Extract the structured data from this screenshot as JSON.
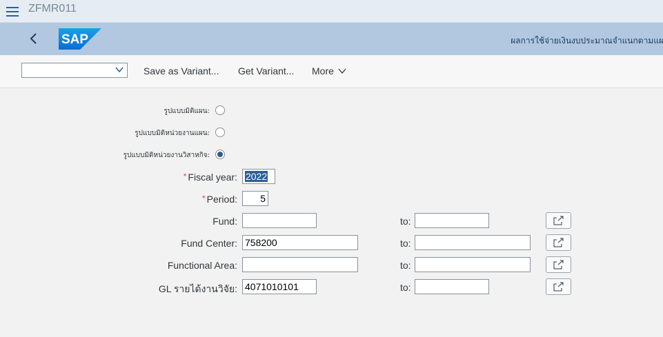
{
  "titlebar": {
    "transaction_code": "ZFMR011"
  },
  "shell": {
    "title": "ผลการใช้จ่ายเงินงบประมาณจำแนกตามแผนงาน"
  },
  "toolbar": {
    "variant_value": "",
    "save_as_variant": "Save as Variant...",
    "get_variant": "Get Variant...",
    "more": "More"
  },
  "form": {
    "radios": [
      {
        "label": "รูปแบบมิติแผน:",
        "selected": false
      },
      {
        "label": "รูปแบบมิติหน่วยงานแผน:",
        "selected": false
      },
      {
        "label": "รูปแบบมิติหน่วยงานวิสาหกิจ:",
        "selected": true
      }
    ],
    "fiscal_year_label": "Fiscal year:",
    "fiscal_year_value": "2022",
    "period_label": "Period:",
    "period_value": "5",
    "to_label": "to:",
    "fund": {
      "label": "Fund:",
      "from": "",
      "to": ""
    },
    "fund_center": {
      "label": "Fund Center:",
      "from": "758200",
      "to": ""
    },
    "functional_area": {
      "label": "Functional Area:",
      "from": "",
      "to": ""
    },
    "gl": {
      "label": "GL รายได้งานวิจัย:",
      "from": "4071010101",
      "to": ""
    }
  },
  "colors": {
    "shell_bg": "#b1c8e0",
    "accent": "#2b5d91",
    "required": "#e34352"
  }
}
